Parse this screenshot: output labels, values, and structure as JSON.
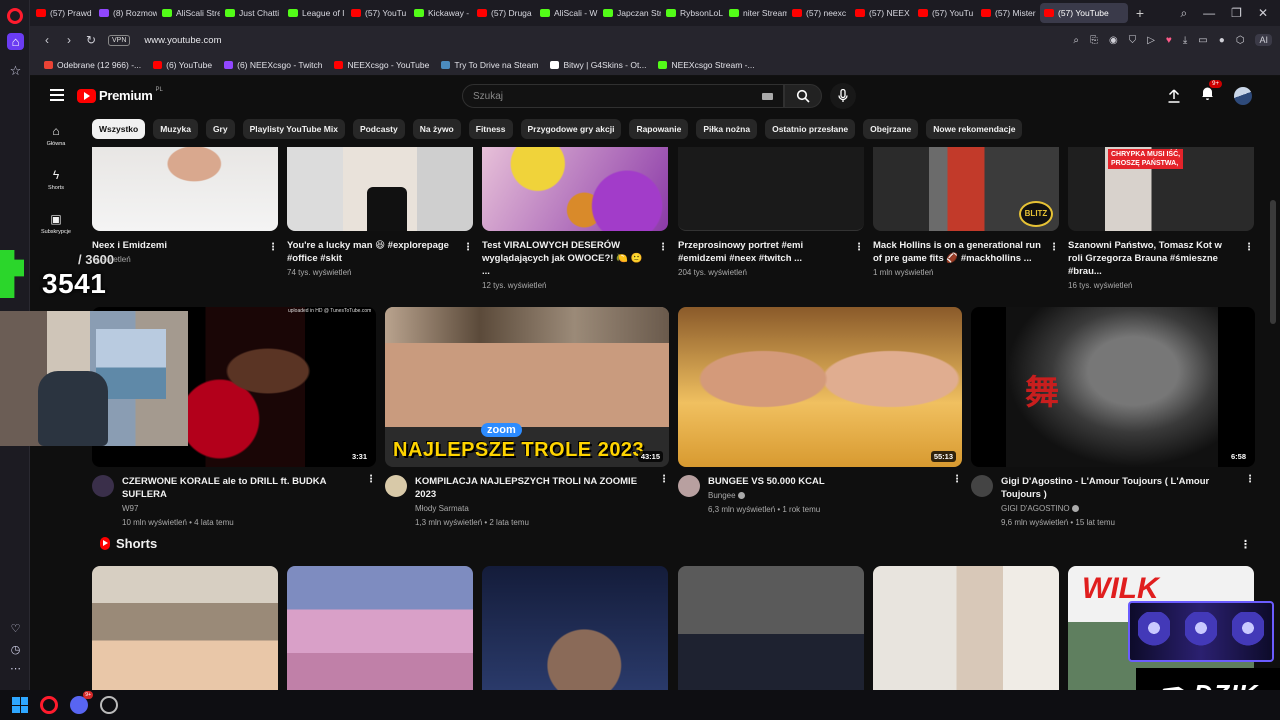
{
  "browser": {
    "tabs": [
      {
        "label": "(57) Prawd",
        "color": "#ff0000"
      },
      {
        "label": "(8) Rozmow",
        "color": "#9147ff"
      },
      {
        "label": "AliScali Stre",
        "color": "#53fc18"
      },
      {
        "label": "Just Chatti",
        "color": "#53fc18"
      },
      {
        "label": "League of I",
        "color": "#53fc18"
      },
      {
        "label": "(57) YouTu",
        "color": "#ff0000"
      },
      {
        "label": "Kickaway -",
        "color": "#53fc18"
      },
      {
        "label": "(57) Druga",
        "color": "#ff0000"
      },
      {
        "label": "AliScali - W",
        "color": "#53fc18"
      },
      {
        "label": "Japczan Str",
        "color": "#53fc18"
      },
      {
        "label": "RybsonLoL",
        "color": "#53fc18"
      },
      {
        "label": "niter Stream",
        "color": "#53fc18"
      },
      {
        "label": "(57) neexc",
        "color": "#ff0000"
      },
      {
        "label": "(57) NEEX",
        "color": "#ff0000"
      },
      {
        "label": "(57) YouTu",
        "color": "#ff0000"
      },
      {
        "label": "(57) Mister",
        "color": "#ff0000"
      },
      {
        "label": "(57) YouTube",
        "color": "#ff0000"
      }
    ],
    "active_tab_index": 16,
    "url": "www.youtube.com",
    "vpn_label": "VPN",
    "ai_label": "AI",
    "bookmarks": [
      {
        "label": "Odebrane (12 966) -...",
        "color": "#ea4335"
      },
      {
        "label": "(6) YouTube",
        "color": "#ff0000"
      },
      {
        "label": "(6) NEEXcsgo - Twitch",
        "color": "#9147ff"
      },
      {
        "label": "NEEXcsgo - YouTube",
        "color": "#ff0000"
      },
      {
        "label": "Try To Drive na Steam",
        "color": "#4b8bbe"
      },
      {
        "label": "Bitwy | G4Skins - Ot...",
        "color": "#ffffff"
      },
      {
        "label": "NEEXcsgo Stream -...",
        "color": "#53fc18"
      }
    ]
  },
  "youtube": {
    "logo_text": "Premium",
    "country_code": "PL",
    "search_placeholder": "Szukaj",
    "notification_count": "9+",
    "nav": [
      {
        "label": "Główna",
        "icon": "home-icon"
      },
      {
        "label": "Shorts",
        "icon": "shorts-icon"
      },
      {
        "label": "Subskrypcje",
        "icon": "subscriptions-icon"
      }
    ],
    "chips": [
      "Wszystko",
      "Muzyka",
      "Gry",
      "Playlisty YouTube Mix",
      "Podcasty",
      "Na żywo",
      "Fitness",
      "Przygodowe gry akcji",
      "Rapowanie",
      "Piłka nożna",
      "Ostatnio przesłane",
      "Obejrzane",
      "Nowe rekomendacje"
    ],
    "active_chip": 0,
    "row1": [
      {
        "title": "Neex i Emidzemi",
        "meta": "wyświetleń"
      },
      {
        "title": "You're a lucky man 😆 #explorepage #office #skit",
        "meta": "74 tys. wyświetleń"
      },
      {
        "title": "Test VIRALOWYCH DESERÓW wyglądających jak OWOCE?! 🍋 🙂 ...",
        "meta": "12 tys. wyświetleń"
      },
      {
        "title": "Przeprosinowy portret #emi #emidzemi #neex #twitch ...",
        "meta": "204 tys. wyświetleń"
      },
      {
        "title": "Mack Hollins is on a generational run of pre game fits 🏈 #mackhollins ...",
        "meta": "1 mln wyświetleń"
      },
      {
        "title": "Szanowni Państwo, Tomasz Kot w roli Grzegorza Brauna #śmieszne #brau...",
        "meta": "16 tys. wyświetleń"
      }
    ],
    "row1_overlays": {
      "blitz": "BLITZ",
      "chrypka_line1": "CHRYPKA MUSI IŚĆ,",
      "chrypka_line2": "PROSZĘ PAŃSTWA,"
    },
    "row2": [
      {
        "title": "CZERWONE KORALE ale to DRILL ft. BUDKA SUFLERA",
        "channel": "W97",
        "stats": "10 mln wyświetleń • 4 lata temu",
        "duration": "3:31",
        "verified": false,
        "watermark": "uploaded in HD @ TunesToTube.com"
      },
      {
        "title": "KOMPILACJA NAJLEPSZYCH TROLI NA ZOOMIE 2023",
        "channel": "Młody Sarmata",
        "stats": "1,3 mln wyświetleń • 2 lata temu",
        "duration": "43:15",
        "verified": false,
        "overlay_text": "NAJLEPSZE TROLE 2023",
        "overlay_brand": "zoom"
      },
      {
        "title": "BUNGEE VS 50.000 KCAL",
        "channel": "Bungee",
        "stats": "6,3 mln wyświetleń • 1 rok temu",
        "duration": "55:13",
        "verified": true
      },
      {
        "title": "Gigi D'Agostino - L'Amour Toujours ( L'Amour Toujours )",
        "channel": "GIGI D'AGOSTINO",
        "stats": "9,6 mln wyświetleń • 15 lat temu",
        "duration": "6:58",
        "verified": true,
        "overlay_text": "舞"
      }
    ],
    "shorts_title": "Shorts",
    "shorts_overlay_text": "WILK"
  },
  "overlay": {
    "counter_current": "3541",
    "counter_total": "/ 3600",
    "brand_text": "DZIK"
  },
  "taskbar": {
    "discord_badge": "9+"
  }
}
